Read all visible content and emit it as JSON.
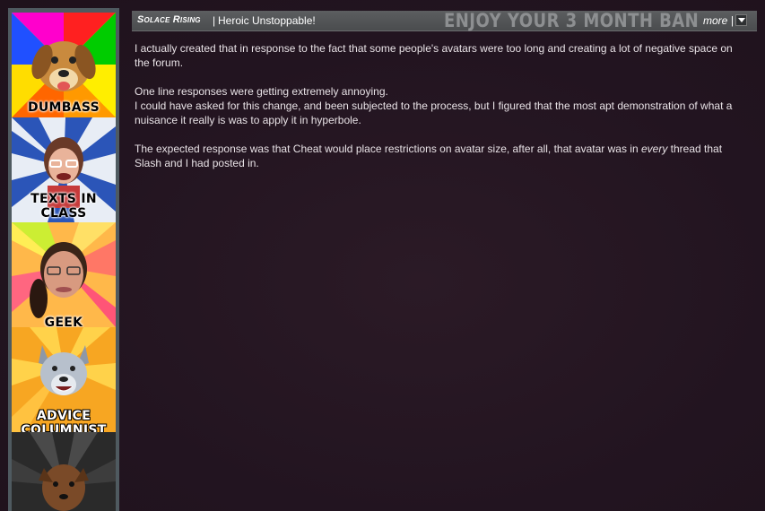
{
  "avatar": {
    "captions": [
      "DUMBASS",
      "TEXTS IN CLASS",
      "GEEK",
      "ADVICE COLUMNIST"
    ]
  },
  "post": {
    "username": "Solace Rising",
    "separator": "|",
    "user_title": "Heroic Unstoppable!",
    "banner": "ENJOY YOUR 3 MONTH BAN",
    "more_label": "more",
    "more_separator": "|",
    "paragraphs": [
      "I actually created that in response to the fact that some people's avatars were too long and creating a lot of negative space on the forum.",
      "One line responses were getting extremely annoying.",
      "I could have asked for this change, and been subjected to the process, but I figured that the most apt demonstration of what a nuisance it really is was to apply it in hyperbole.",
      "The expected response was that Cheat would place restrictions on avatar size, after all, that avatar was in",
      "every",
      "thread that Slash and I had posted in."
    ]
  },
  "colors": {
    "background": "#231520",
    "header_bar": "#555759",
    "text": "#e8e2e6",
    "avatar_frame": "#4f5a60"
  }
}
